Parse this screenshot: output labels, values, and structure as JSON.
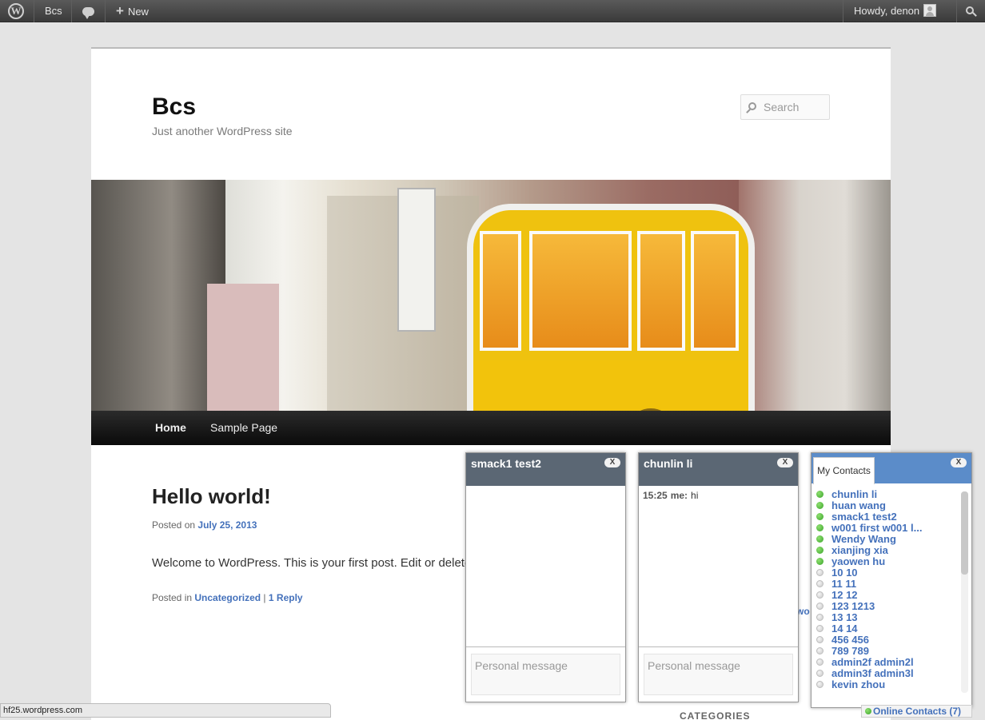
{
  "adminbar": {
    "site_name": "Bcs",
    "new_label": "New",
    "howdy": "Howdy, denon"
  },
  "site": {
    "title": "Bcs",
    "description": "Just another WordPress site",
    "search_placeholder": "Search"
  },
  "nav": {
    "items": [
      {
        "label": "Home"
      },
      {
        "label": "Sample Page"
      }
    ]
  },
  "post": {
    "title": "Hello world!",
    "posted_on_prefix": "Posted on",
    "date": "July 25, 2013",
    "content": "Welcome to WordPress. This is your first post. Edit or delete it",
    "posted_in_prefix": "Posted in",
    "category": "Uncategorized",
    "separator": "|",
    "reply": "1 Reply"
  },
  "sidebar": {
    "peek_text": "wo",
    "categories_heading": "CATEGORIES"
  },
  "statusbar": {
    "url": "hf25.wordpress.com"
  },
  "chats": [
    {
      "name": "smack1 test2",
      "close": "X",
      "messages": [],
      "input_placeholder": "Personal message"
    },
    {
      "name": "chunlin li",
      "close": "X",
      "messages": [
        {
          "time": "15:25",
          "sender": "me:",
          "text": "hi"
        }
      ],
      "input_placeholder": "Personal message"
    }
  ],
  "contacts": {
    "tab_label": "My Contacts",
    "close": "X",
    "list": [
      {
        "name": "chunlin li",
        "online": true
      },
      {
        "name": "huan wang",
        "online": true
      },
      {
        "name": "smack1 test2",
        "online": true
      },
      {
        "name": "w001 first w001 l...",
        "online": true
      },
      {
        "name": "Wendy Wang",
        "online": true
      },
      {
        "name": "xianjing xia",
        "online": true
      },
      {
        "name": "yaowen hu",
        "online": true
      },
      {
        "name": "10 10",
        "online": false
      },
      {
        "name": "11 11",
        "online": false
      },
      {
        "name": "12 12",
        "online": false
      },
      {
        "name": "123 1213",
        "online": false
      },
      {
        "name": "13 13",
        "online": false
      },
      {
        "name": "14 14",
        "online": false
      },
      {
        "name": "456 456",
        "online": false
      },
      {
        "name": "789 789",
        "online": false
      },
      {
        "name": "admin2f admin2l",
        "online": false
      },
      {
        "name": "admin3f admin3l",
        "online": false
      },
      {
        "name": "kevin zhou",
        "online": false
      }
    ],
    "footer": "Online Contacts (7)"
  },
  "colors": {
    "link": "#4471bb",
    "chat_header": "#5b6774",
    "contacts_header": "#5b8cc9",
    "online": "#3aa32a"
  }
}
